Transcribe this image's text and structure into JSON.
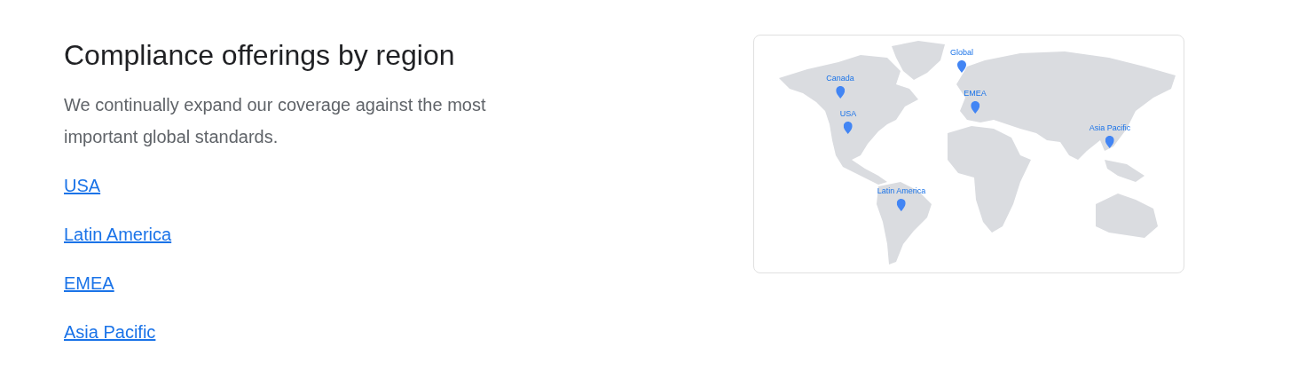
{
  "heading": "Compliance offerings by region",
  "description": "We continually expand our coverage against the most important global standards.",
  "links": [
    {
      "label": "USA"
    },
    {
      "label": "Latin America"
    },
    {
      "label": "EMEA"
    },
    {
      "label": "Asia Pacific"
    }
  ],
  "map": {
    "markers": [
      {
        "label": "Global"
      },
      {
        "label": "Canada"
      },
      {
        "label": "EMEA"
      },
      {
        "label": "USA"
      },
      {
        "label": "Asia Pacific"
      },
      {
        "label": "Latin America"
      }
    ]
  }
}
